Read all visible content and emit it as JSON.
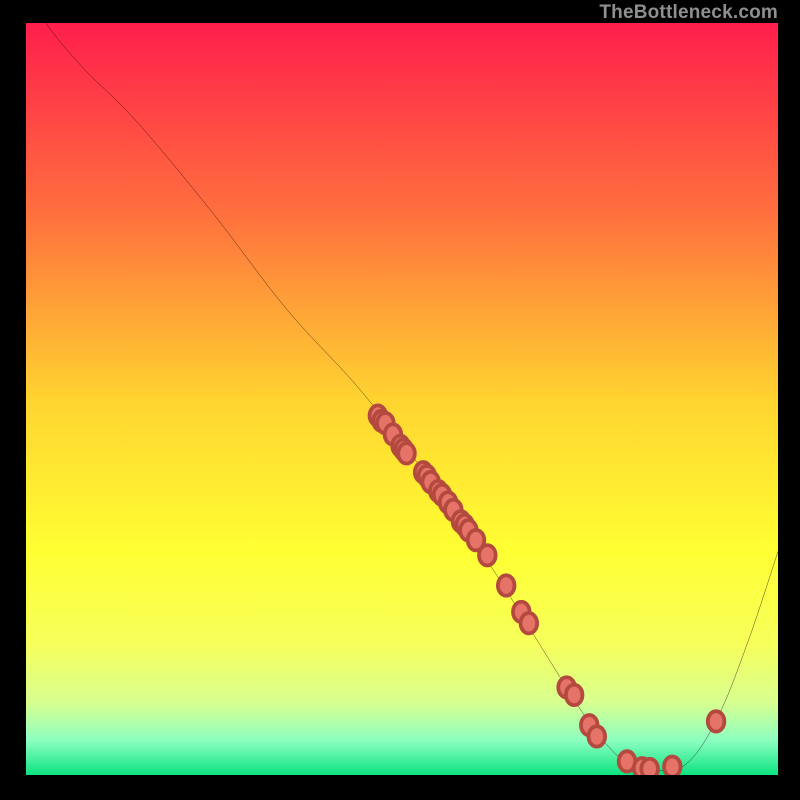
{
  "watermark": "TheBottleneck.com",
  "chart_data": {
    "type": "line",
    "title": "",
    "xlabel": "",
    "ylabel": "",
    "xlim": [
      0,
      100
    ],
    "ylim": [
      0,
      100
    ],
    "legend": false,
    "grid": false,
    "background_gradient": {
      "type": "vertical",
      "stops": [
        {
          "pos": 0.0,
          "color": "#ff1e4c"
        },
        {
          "pos": 0.25,
          "color": "#ff6f3e"
        },
        {
          "pos": 0.5,
          "color": "#ffd430"
        },
        {
          "pos": 0.7,
          "color": "#ffff33"
        },
        {
          "pos": 0.82,
          "color": "#f7ff5a"
        },
        {
          "pos": 0.9,
          "color": "#d8ff90"
        },
        {
          "pos": 0.95,
          "color": "#8dffc0"
        },
        {
          "pos": 1.0,
          "color": "#00e07a"
        }
      ]
    },
    "series": [
      {
        "name": "bottleneck-curve",
        "x": [
          0,
          3,
          8,
          15,
          25,
          35,
          45,
          55,
          62,
          67,
          72,
          76,
          80,
          84,
          88,
          92,
          96,
          100
        ],
        "y": [
          105,
          100,
          94,
          87,
          75,
          62,
          51,
          38,
          28,
          20,
          12,
          6,
          2,
          1,
          2,
          8,
          18,
          30
        ]
      }
    ],
    "points": {
      "name": "sample-points",
      "x": [
        47,
        47.5,
        48,
        49,
        50,
        50.4,
        50.8,
        53,
        53.5,
        54,
        55,
        55.5,
        56.3,
        57,
        58,
        58.5,
        59,
        60,
        61.5,
        64,
        66,
        67,
        72,
        73,
        75,
        76,
        80,
        82,
        83,
        86,
        91.8
      ],
      "y": [
        48,
        47.3,
        47,
        45.5,
        44,
        43.5,
        43,
        40.5,
        40,
        39.2,
        38,
        37.5,
        36.5,
        35.5,
        34,
        33.5,
        32.8,
        31.5,
        29.5,
        25.5,
        22,
        20.5,
        12,
        11,
        7,
        5.5,
        2.2,
        1.3,
        1.2,
        1.5,
        7.5
      ]
    }
  }
}
